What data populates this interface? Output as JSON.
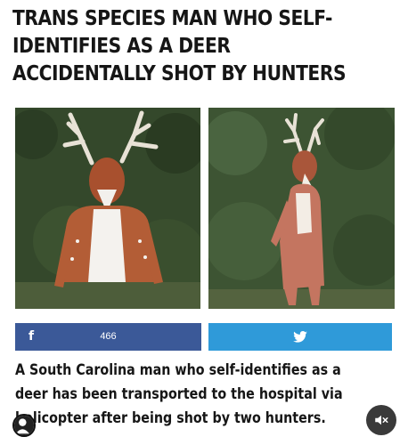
{
  "headline": {
    "line1": "TRANS SPECIES MAN WHO SELF-",
    "line2": "IDENTIFIES AS A DEER",
    "line3": "ACCIDENTALLY SHOT BY HUNTERS"
  },
  "images": [
    {
      "icon": "deer-costume-photo-front"
    },
    {
      "icon": "deer-costume-photo-side"
    }
  ],
  "share": {
    "facebook": {
      "icon": "facebook-icon",
      "count": "466",
      "color": "#3b5998"
    },
    "twitter": {
      "icon": "twitter-icon",
      "color": "#2f9ad9"
    }
  },
  "article": {
    "line1": "A South Carolina man who self-identifies as a",
    "line2": "deer has been transported to the hospital via",
    "line3": "helicopter after being shot by two hunters."
  },
  "overlay": {
    "avatar_icon": "user-avatar-icon",
    "mute_icon": "speaker-muted-icon"
  }
}
